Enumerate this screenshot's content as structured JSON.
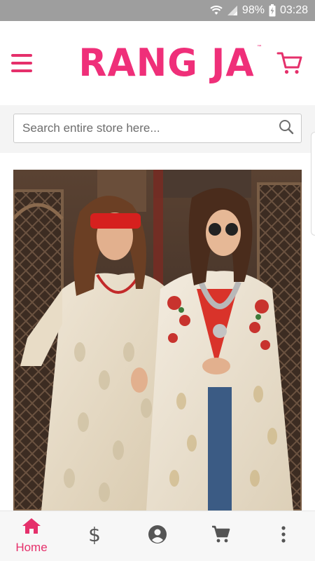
{
  "status_bar": {
    "battery": "98%",
    "time": "03:28",
    "icons": [
      "wifi-icon",
      "signal-icon",
      "battery-charging-icon"
    ]
  },
  "header": {
    "logo_text": "RANG JA",
    "logo_tm": "™",
    "icons": [
      "hamburger-menu-icon",
      "cart-icon"
    ]
  },
  "search": {
    "placeholder": "Search entire store here...",
    "icon": "search-icon"
  },
  "hero": {
    "image_label": "Fashion banner photo"
  },
  "bottom_nav": {
    "items": [
      {
        "label": "Home",
        "icon": "home-icon",
        "active": true
      },
      {
        "label": "",
        "icon": "dollar-icon",
        "active": false
      },
      {
        "label": "",
        "icon": "account-icon",
        "active": false
      },
      {
        "label": "",
        "icon": "cart-icon",
        "active": false
      },
      {
        "label": "",
        "icon": "more-vertical-icon",
        "active": false
      }
    ]
  },
  "colors": {
    "brand": "#ef2f79",
    "accent": "#e5306b",
    "status_bar": "#9e9e9e",
    "nav_icon": "#555555"
  }
}
